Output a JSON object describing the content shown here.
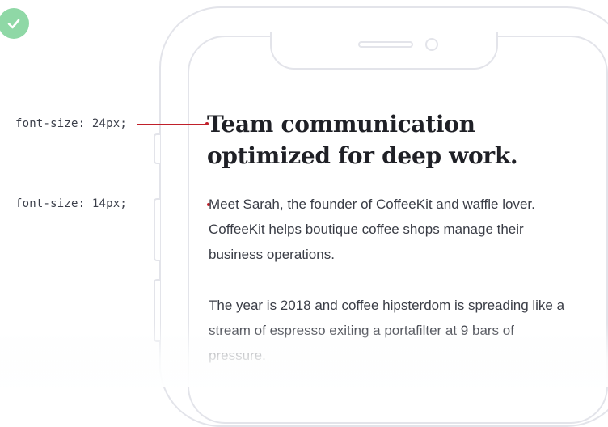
{
  "annotations": {
    "heading_label": "font-size: 24px;",
    "body_label": "font-size: 14px;"
  },
  "content": {
    "headline": "Team communication optimized for deep work.",
    "paragraph_1": "Meet Sarah, the founder of CoffeeKit and waffle lover. CoffeeKit helps boutique coffee shops manage their business operations.",
    "paragraph_2": "The year is 2018 and coffee hipsterdom is spreading like a stream of espresso exiting a portafilter at 9 bars of pressure."
  },
  "colors": {
    "check_badge": "#8fd8a6",
    "annotation_line": "#c0202a",
    "phone_outline": "#e3e4ea",
    "headline_text": "#1f2026",
    "body_text": "#3a3d46"
  },
  "icons": {
    "badge": "checkmark-icon"
  }
}
